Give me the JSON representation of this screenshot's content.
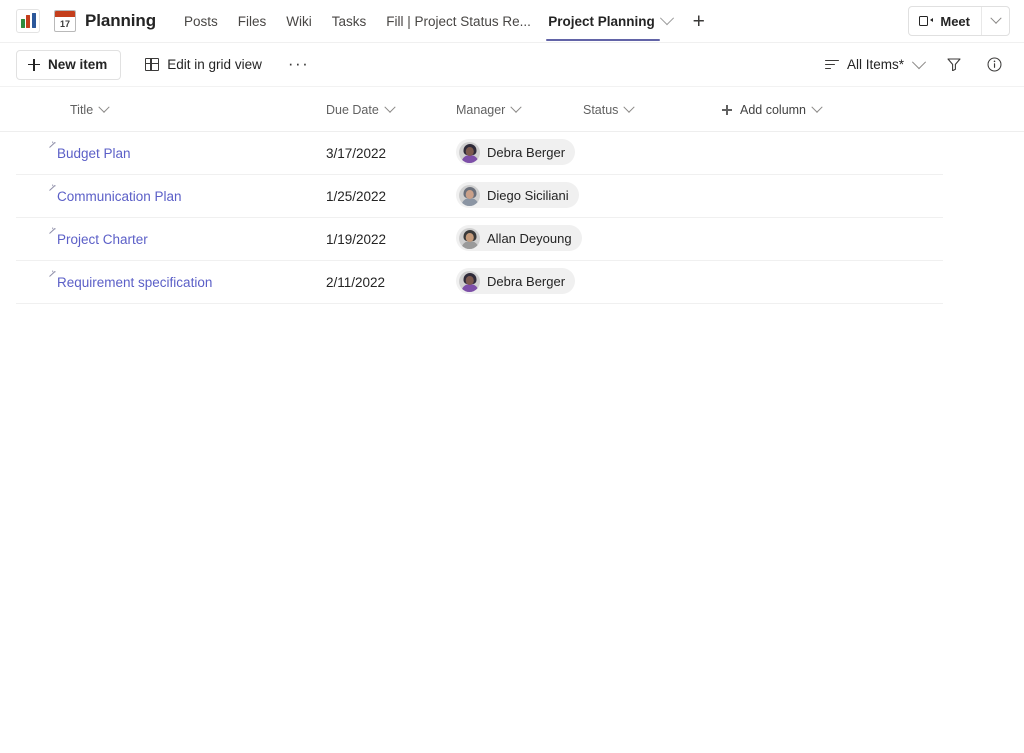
{
  "header": {
    "app_icon": "bar-chart-icon",
    "calendar_icon_day": "17",
    "site_title": "Planning",
    "tabs": [
      {
        "label": "Posts",
        "active": false
      },
      {
        "label": "Files",
        "active": false
      },
      {
        "label": "Wiki",
        "active": false
      },
      {
        "label": "Tasks",
        "active": false
      },
      {
        "label": "Fill | Project Status Re...",
        "active": false
      },
      {
        "label": "Project Planning",
        "active": true
      }
    ],
    "add_tab_label": "+",
    "meet": {
      "label": "Meet",
      "icon": "camera-icon",
      "caret": "chevron-down-icon"
    }
  },
  "toolbar": {
    "new_item_label": "New item",
    "edit_grid_label": "Edit in grid view",
    "more_label": "···",
    "view_label": "All Items*",
    "filter_icon": "filter-icon",
    "info_icon": "info-icon"
  },
  "list": {
    "columns": [
      {
        "label": "Title"
      },
      {
        "label": "Due Date"
      },
      {
        "label": "Manager"
      },
      {
        "label": "Status"
      },
      {
        "label": "Add column"
      }
    ],
    "rows": [
      {
        "title": "Budget Plan",
        "due_date": "3/17/2022",
        "manager": "Debra Berger",
        "status": "",
        "avatar_colors": {
          "hair": "#2f2b3a",
          "face": "#7d5a4f",
          "body": "#7d4fa8"
        }
      },
      {
        "title": "Communication Plan",
        "due_date": "1/25/2022",
        "manager": "Diego Siciliani",
        "status": "",
        "avatar_colors": {
          "hair": "#6a6f7a",
          "face": "#c9a089",
          "body": "#8b95a3"
        }
      },
      {
        "title": "Project Charter",
        "due_date": "1/19/2022",
        "manager": "Allan Deyoung",
        "status": "",
        "avatar_colors": {
          "hair": "#3a3a3a",
          "face": "#c59b7b",
          "body": "#9a9a9a"
        }
      },
      {
        "title": "Requirement specification",
        "due_date": "2/11/2022",
        "manager": "Debra Berger",
        "status": "",
        "avatar_colors": {
          "hair": "#2f2b3a",
          "face": "#7d5a4f",
          "body": "#7d4fa8"
        }
      }
    ]
  },
  "colors": {
    "accent": "#6264a7",
    "link": "#5b5fc7",
    "text": "#242424",
    "muted": "#616161",
    "chip_bg": "#f0f0f0",
    "divider": "#f0f0f0"
  }
}
